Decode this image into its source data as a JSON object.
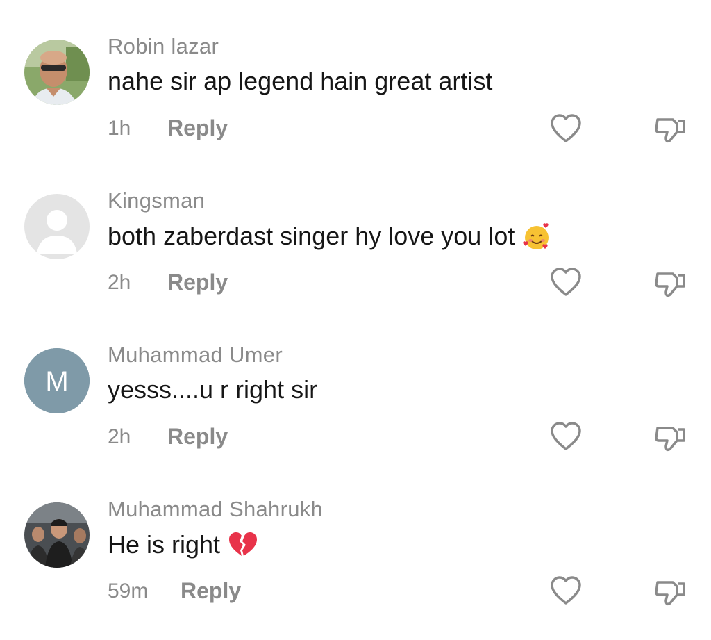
{
  "comments": [
    {
      "username": "Robin lazar",
      "text": "nahe sir ap legend hain great artist",
      "time": "1h",
      "reply_label": "Reply",
      "avatar": "photo-man-sunglasses",
      "emoji": ""
    },
    {
      "username": "Kingsman",
      "text": "both zaberdast singer hy love you lot",
      "time": "2h",
      "reply_label": "Reply",
      "avatar": "default-user-icon",
      "emoji": "smiling-face-with-hearts"
    },
    {
      "username": "Muhammad Umer",
      "text": "yesss....u r right sir",
      "time": "2h",
      "reply_label": "Reply",
      "avatar": "letter-avatar",
      "avatar_letter": "M",
      "avatar_color": "#7f9aa8",
      "emoji": ""
    },
    {
      "username": "Muhammad Shahrukh",
      "text": "He is right",
      "time": "59m",
      "reply_label": "Reply",
      "avatar": "photo-group",
      "emoji": "broken-heart"
    }
  ],
  "colors": {
    "username": "#8a8a8a",
    "text": "#161616",
    "icon": "#8a8a8a"
  },
  "icons": {
    "like": "heart-outline-icon",
    "dislike": "thumbs-down-outline-icon"
  }
}
